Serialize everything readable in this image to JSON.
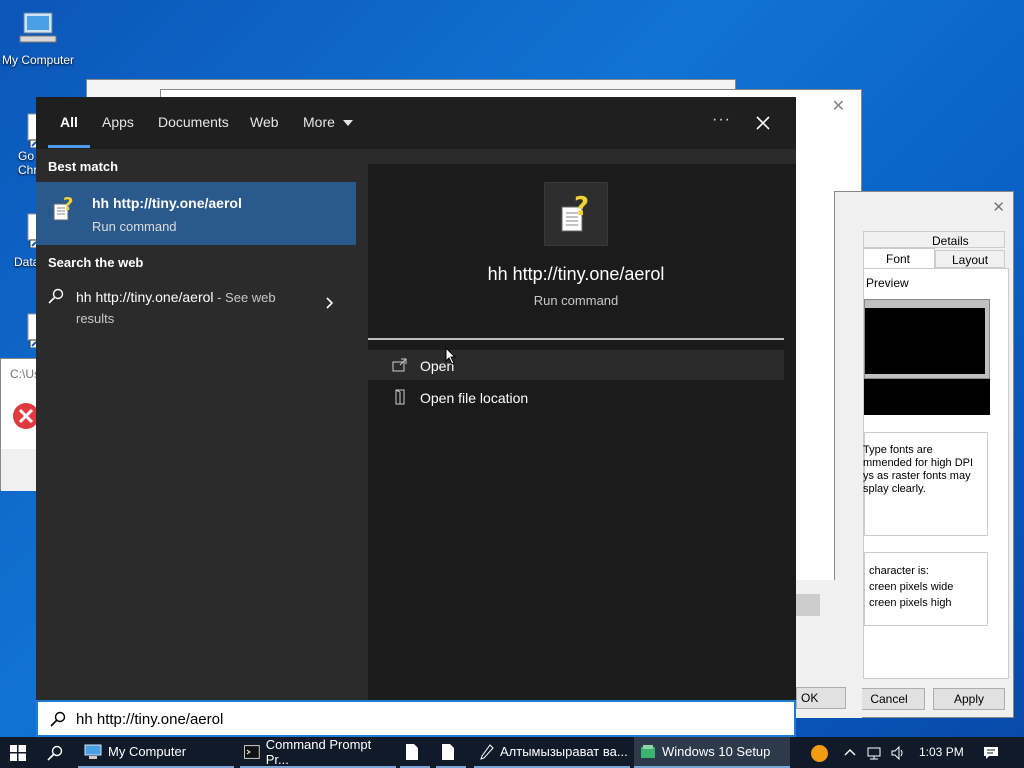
{
  "desktop": {
    "icons": [
      {
        "label": "My Computer"
      },
      {
        "label": "Go\nChr"
      },
      {
        "label": "DataW"
      }
    ]
  },
  "bg_dialog": {
    "tabs": [
      "Details",
      "Font",
      "Layout"
    ],
    "preview_label": "Preview",
    "note_text": "Type fonts are\nmmended for high DPI\nys as raster fonts may\nsplay clearly.",
    "char_text": "character is:\ncreen pixels wide\ncreen pixels high",
    "buttons": {
      "ok": "OK",
      "cancel": "Cancel",
      "apply": "Apply"
    }
  },
  "error_dialog": {
    "path_text": "C:\\Us"
  },
  "search": {
    "tabs": [
      {
        "label": "All",
        "active": true
      },
      {
        "label": "Apps"
      },
      {
        "label": "Documents"
      },
      {
        "label": "Web"
      },
      {
        "label": "More"
      }
    ],
    "more_options_label": "···",
    "best_match_heading": "Best match",
    "best_match": {
      "title": "hh http://tiny.one/aerol",
      "subtitle": "Run command"
    },
    "web_heading": "Search the web",
    "web_item": {
      "query": "hh http://tiny.one/aerol",
      "suffix": " - See web results"
    },
    "preview": {
      "title": "hh http://tiny.one/aerol",
      "subtitle": "Run command"
    },
    "actions": [
      {
        "label": "Open",
        "icon": "open-icon"
      },
      {
        "label": "Open file location",
        "icon": "file-location-icon"
      }
    ],
    "query": "hh http://tiny.one/aerol"
  },
  "taskbar": {
    "items": [
      {
        "label": "My Computer"
      },
      {
        "label": "Command Prompt Pr..."
      },
      {
        "label": ""
      },
      {
        "label": ""
      },
      {
        "label": "Алтымызырават ва..."
      },
      {
        "label": "Windows 10 Setup"
      }
    ],
    "clock": "1:03 PM"
  },
  "colors": {
    "accent": "#1e7bd6",
    "selected": "#2a5a8c",
    "panel": "#2b2b2b"
  }
}
